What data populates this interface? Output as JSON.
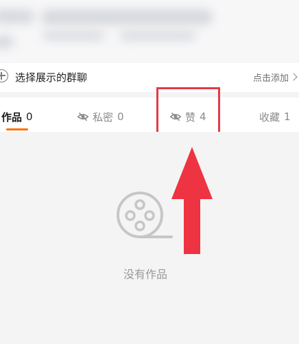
{
  "group_section": {
    "label": "选择展示的群聊",
    "add_label": "点击添加"
  },
  "tabs": [
    {
      "label": "作品",
      "count": "0",
      "active": true,
      "icon": null
    },
    {
      "label": "私密",
      "count": "0",
      "active": false,
      "icon": "hidden-eye-icon"
    },
    {
      "label": "赞",
      "count": "4",
      "active": false,
      "icon": "hidden-eye-icon"
    },
    {
      "label": "收藏",
      "count": "1",
      "active": false,
      "icon": null
    }
  ],
  "content": {
    "empty_text": "没有作品",
    "empty_icon": "film-reel-icon"
  },
  "colors": {
    "accent": "#ff6f00",
    "annotation": "#e23a47",
    "muted": "#999999"
  }
}
